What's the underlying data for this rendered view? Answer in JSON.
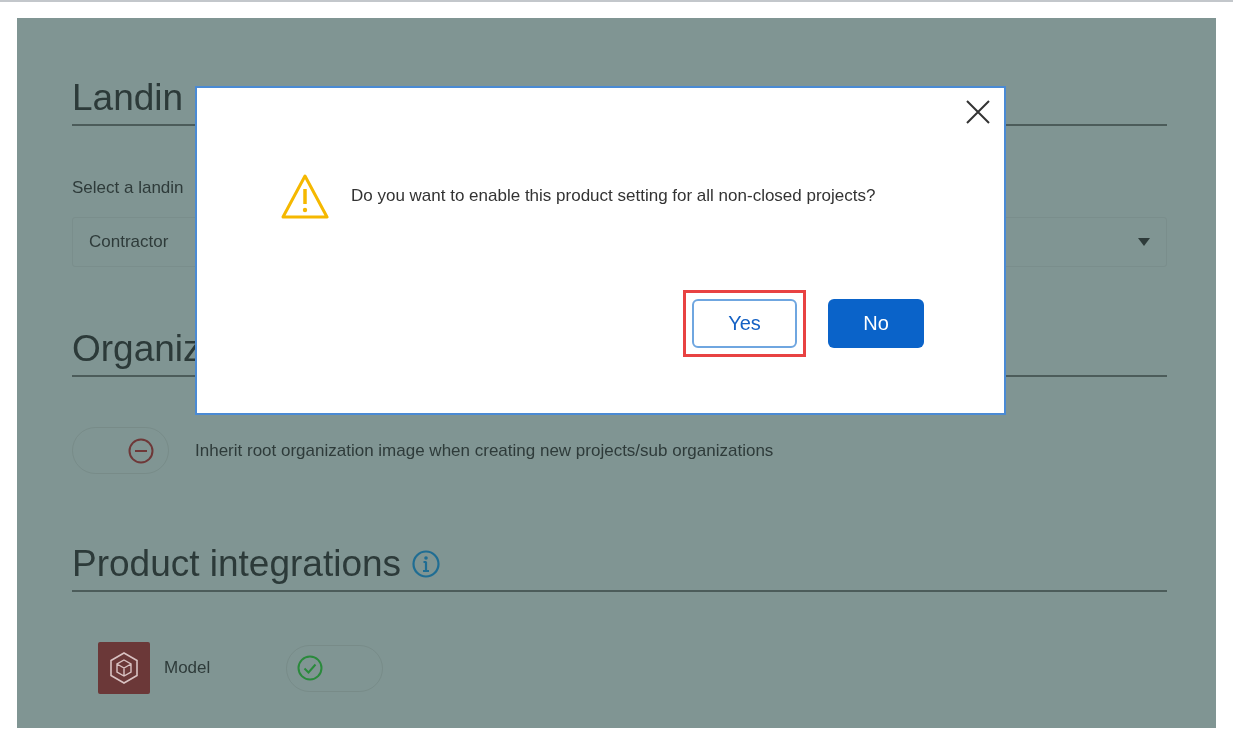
{
  "sections": [
    {
      "kind": "select",
      "heading": "Landin",
      "label": "Select a landin",
      "value": "Contractor"
    },
    {
      "kind": "toggle",
      "heading": "Organiz",
      "on": false,
      "text": "Inherit root organization image when creating new projects/sub organizations"
    },
    {
      "kind": "integrations",
      "heading": "Product integrations",
      "items": [
        {
          "name": "Model",
          "on": true
        }
      ]
    }
  ],
  "dialog": {
    "message": "Do you want to enable this product setting for all non-closed projects?",
    "buttons": [
      {
        "label": "Yes",
        "kind": "secondary",
        "highlighted": true
      },
      {
        "label": "No",
        "kind": "primary",
        "highlighted": false
      }
    ]
  }
}
